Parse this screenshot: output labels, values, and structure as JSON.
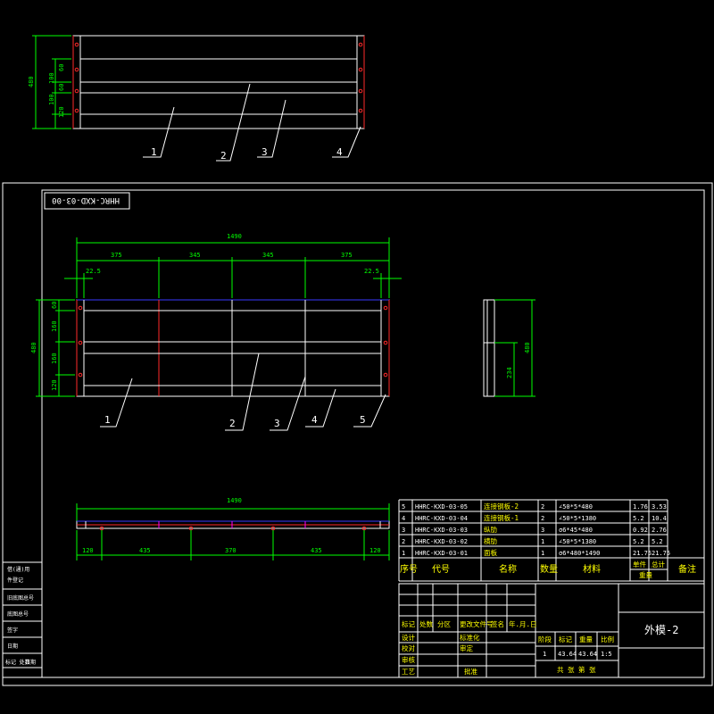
{
  "colors": {
    "background": "#000000",
    "line": "#ffffff",
    "dimension": "#00ff00",
    "red": "#ff2a2a",
    "blue": "#3a3aff",
    "magenta": "#ff00ff",
    "title_text": "#ffff00"
  },
  "top_view": {
    "overall_dim": "480",
    "dims": [
      "60",
      "100",
      "60",
      "100",
      "120"
    ],
    "callouts": [
      "1",
      "2",
      "3",
      "4"
    ]
  },
  "drawing_number": "HHRC-KXD-03-00",
  "front_view": {
    "overall_width": "1490",
    "segments": [
      "375",
      "345",
      "345",
      "375"
    ],
    "edge_left": "22.5",
    "edge_right": "22.5",
    "overall_height": "480",
    "height_dims": [
      "60",
      "160",
      "160",
      "120"
    ],
    "callouts": [
      "1",
      "2",
      "3",
      "4",
      "5"
    ]
  },
  "side_view": {
    "overall_height": "480",
    "lower_dim": "234"
  },
  "bottom_view": {
    "overall_width": "1490",
    "segments": [
      "120",
      "435",
      "370",
      "435",
      "120"
    ]
  },
  "parts_list": {
    "rows": [
      {
        "no": "5",
        "code": "HHRC-KXD-03-05",
        "name": "连接钢板-2",
        "qty": "2",
        "material": "∠50*5*480",
        "unit": "1.76",
        "total": "3.53"
      },
      {
        "no": "4",
        "code": "HHRC-KXD-03-04",
        "name": "连接钢板-1",
        "qty": "2",
        "material": "∠50*5*1380",
        "unit": "5.2",
        "total": "10.4"
      },
      {
        "no": "3",
        "code": "HHRC-KXD-03-03",
        "name": "纵肋",
        "qty": "3",
        "material": "σ6*45*480",
        "unit": "0.92",
        "total": "2.76"
      },
      {
        "no": "2",
        "code": "HHRC-KXD-03-02",
        "name": "横肋",
        "qty": "1",
        "material": "∠50*5*1380",
        "unit": "5.2",
        "total": "5.2"
      },
      {
        "no": "1",
        "code": "HHRC-KXD-03-01",
        "name": "面板",
        "qty": "1",
        "material": "σ6*480*1490",
        "unit": "21.75",
        "total": "21.75"
      }
    ],
    "headers": {
      "no": "序号",
      "code": "代号",
      "name": "名称",
      "qty": "数量",
      "material": "材料",
      "unit": "单件",
      "total": "总计",
      "weight": "重量",
      "remark": "备注"
    }
  },
  "title_block": {
    "drawing_title": "外模-2",
    "sig_labels": [
      "标记",
      "处数",
      "分区",
      "更改文件号",
      "签名",
      "年.月.日"
    ],
    "role_labels": [
      "设计",
      "标准化",
      "校对",
      "审核",
      "审定",
      "工艺",
      "批准"
    ],
    "stage_headers": [
      "阶段",
      "标记",
      "重量",
      "比例"
    ],
    "stage_values": [
      "1",
      "43.64",
      "43.64",
      "1:5"
    ],
    "sheet_text": "共 张 第 张"
  },
  "left_strip": [
    "借(通)用",
    "件登记",
    "旧底图总号",
    "底图总号",
    "签字",
    "日期",
    "标记 处数",
    "日期"
  ]
}
